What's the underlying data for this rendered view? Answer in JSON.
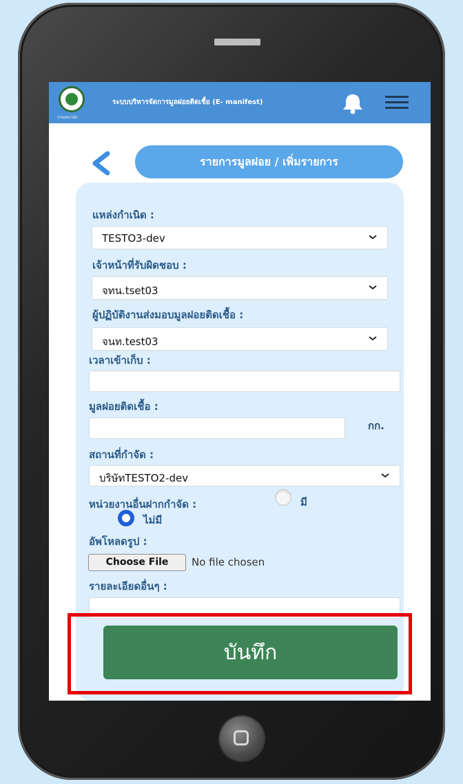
{
  "header": {
    "app_title": "ระบบบริหารจัดการมูลฝอยติดเชื้อ (E- manifest)",
    "logo_caption": "กรมอนามัย"
  },
  "page": {
    "title": "รายการมูลฝอย / เพิ่มรายการ"
  },
  "form": {
    "source_label": "แหล่งกำเนิด :",
    "source_value": "TESTO3-dev",
    "officer_label": "เจ้าหน้าที่รับผิดชอบ :",
    "officer_value": "จทน.tset03",
    "deliverer_label": "ผู้ปฏิบัติงานส่งมอบมูลฝอยติดเชื้อ :",
    "deliverer_value": "จนท.test03",
    "collect_time_label": "เวลาเข้าเก็บ :",
    "collect_time_value": "",
    "waste_label": "มูลฝอยติดเชื้อ :",
    "waste_value": "",
    "waste_unit": "กก.",
    "disposal_label": "สถานที่กำจัด :",
    "disposal_value": "บริษัทTESTO2-dev",
    "other_agency_label": "หน่วยงานอื่นฝากกำจัด :",
    "option_yes": "มี",
    "option_no": "ไม่มี",
    "selected_option": "ไม่มี",
    "upload_label": "อัพโหลดรูป :",
    "file_button": "Choose File",
    "file_status": "No file chosen",
    "details_label": "รายละเอียดอื่นๆ :",
    "details_value": ""
  },
  "actions": {
    "save_label": "บันทึก"
  },
  "colors": {
    "header_bg": "#4a90d6",
    "title_pill": "#5aa7ea",
    "save_button": "#3d8556",
    "highlight": "#e60000",
    "label_text": "#2b5b8a"
  }
}
